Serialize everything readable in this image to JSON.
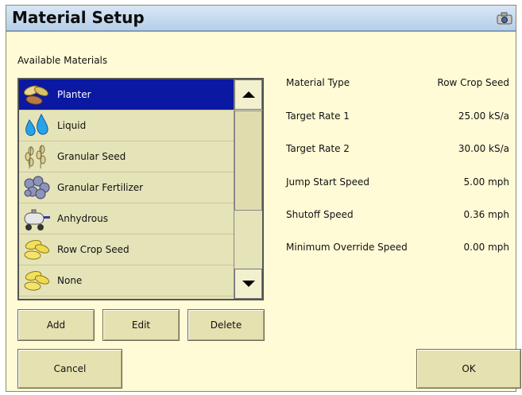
{
  "window": {
    "title": "Material Setup",
    "title_icon": "camera-icon"
  },
  "materials": {
    "label": "Available Materials",
    "items": [
      {
        "label": "Planter",
        "icon": "planter-seeds-icon",
        "selected": true
      },
      {
        "label": "Liquid",
        "icon": "liquid-drops-icon",
        "selected": false
      },
      {
        "label": "Granular Seed",
        "icon": "grain-seed-icon",
        "selected": false
      },
      {
        "label": "Granular Fertilizer",
        "icon": "fertilizer-pellets-icon",
        "selected": false
      },
      {
        "label": "Anhydrous",
        "icon": "anhydrous-tank-icon",
        "selected": false
      },
      {
        "label": "Row Crop Seed",
        "icon": "row-crop-seed-icon",
        "selected": false
      },
      {
        "label": "None",
        "icon": "none-seed-icon",
        "selected": false
      }
    ],
    "selected_color": "#0a18a2"
  },
  "buttons": {
    "add": "Add",
    "edit": "Edit",
    "delete": "Delete",
    "cancel": "Cancel",
    "ok": "OK"
  },
  "properties": [
    {
      "key": "Material Type",
      "value": "Row Crop Seed"
    },
    {
      "key": "Target Rate 1",
      "value": "25.00 kS/a"
    },
    {
      "key": "Target Rate 2",
      "value": "30.00 kS/a"
    },
    {
      "key": "Jump Start Speed",
      "value": "5.00 mph"
    },
    {
      "key": "Shutoff Speed",
      "value": "0.36 mph"
    },
    {
      "key": "Minimum Override Speed",
      "value": "0.00 mph"
    }
  ]
}
